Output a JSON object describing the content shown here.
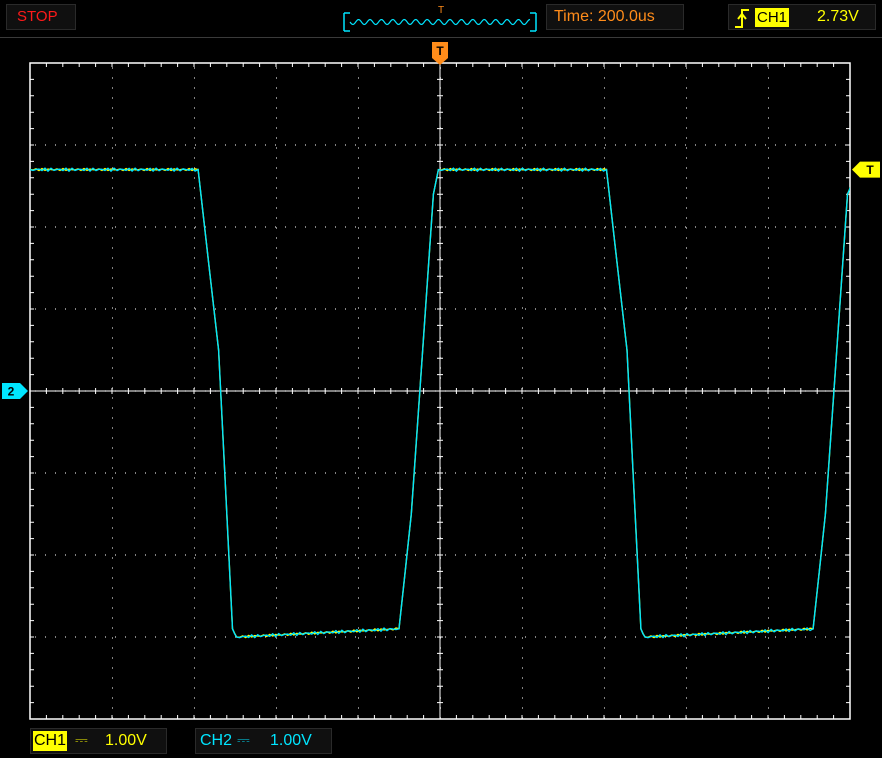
{
  "status": {
    "text": "STOP",
    "color": "#ff1a1a"
  },
  "overview": {
    "marker": "T"
  },
  "timebase": {
    "label": "Time:",
    "value": "200.0us"
  },
  "trigger": {
    "edge_icon": "rising-edge-icon",
    "source": "CH1",
    "level": "2.73V"
  },
  "markers": {
    "trigger_position": "T",
    "trigger_level": "T",
    "ch2_ground": "2"
  },
  "channels": [
    {
      "name": "CH1",
      "coupling": "DC",
      "coupling_symbol": "⎓",
      "scale": "1.00V",
      "color": "#ffff00"
    },
    {
      "name": "CH2",
      "coupling": "DC",
      "coupling_symbol": "⎓",
      "scale": "1.00V",
      "color": "#00e5ff"
    }
  ],
  "colors": {
    "trigger": "#ff8c1a",
    "ch1": "#ffff00",
    "ch2": "#00e5ff",
    "grid": "#ffffff",
    "background": "#000000"
  },
  "chart_data": {
    "type": "line",
    "grid": {
      "divisions_x": 10,
      "divisions_y": 8
    },
    "xlim": [
      0,
      10
    ],
    "ylim": [
      -4,
      4
    ],
    "series": [
      {
        "name": "CH1",
        "x": [
          0,
          2.05,
          2.3,
          2.47,
          2.52,
          4.5,
          4.65,
          4.92,
          4.98,
          7.03,
          7.28,
          7.45,
          7.5,
          9.55,
          9.7,
          9.97,
          10.1
        ],
        "y": [
          2.7,
          2.7,
          0.5,
          -2.9,
          -3.0,
          -2.9,
          -1.5,
          2.4,
          2.7,
          2.7,
          0.5,
          -2.9,
          -3.0,
          -2.9,
          -1.5,
          2.4,
          2.7
        ]
      },
      {
        "name": "CH2",
        "x": [
          0,
          2.05,
          2.3,
          2.47,
          2.52,
          4.5,
          4.65,
          4.92,
          4.98,
          7.03,
          7.28,
          7.45,
          7.5,
          9.55,
          9.7,
          9.97,
          10.1
        ],
        "y": [
          2.7,
          2.7,
          0.5,
          -2.9,
          -3.0,
          -2.9,
          -1.5,
          2.4,
          2.7,
          2.7,
          0.5,
          -2.9,
          -3.0,
          -2.9,
          -1.5,
          2.4,
          2.7
        ]
      }
    ]
  }
}
